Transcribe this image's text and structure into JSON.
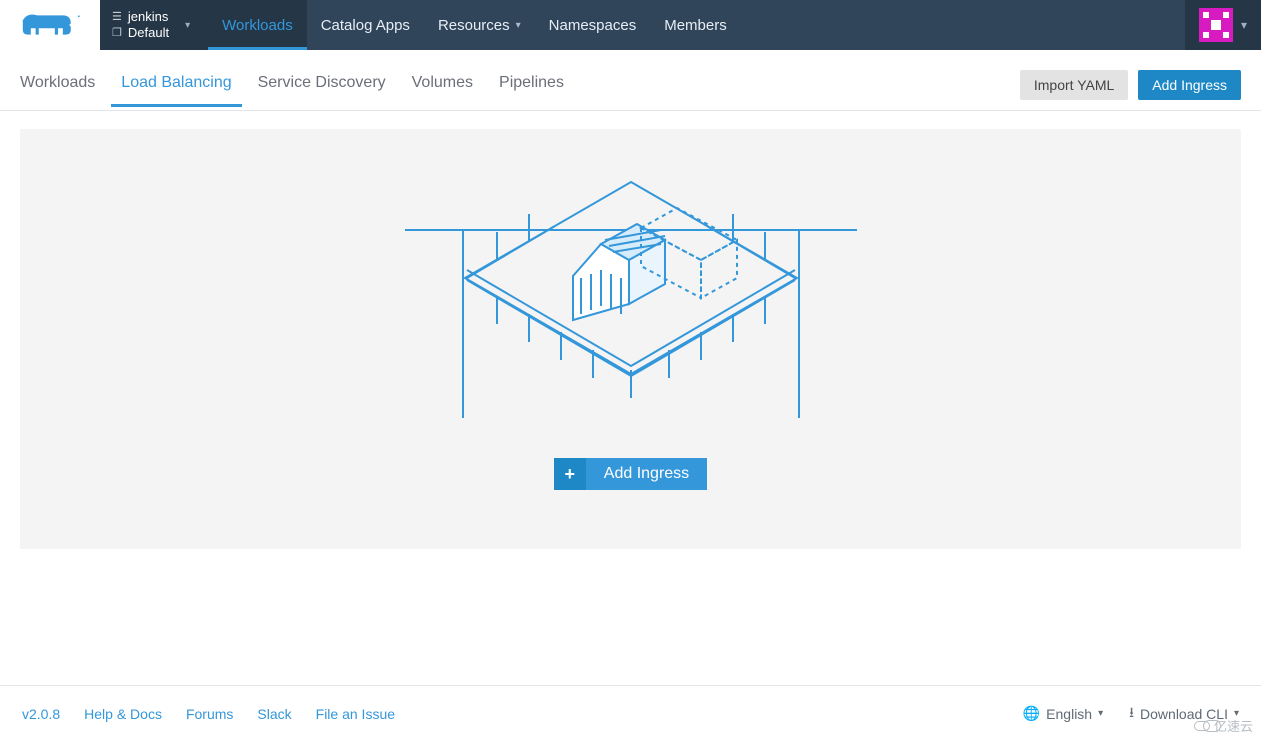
{
  "header": {
    "cluster": "jenkins",
    "project": "Default",
    "nav": [
      {
        "label": "Workloads",
        "active": true
      },
      {
        "label": "Catalog Apps"
      },
      {
        "label": "Resources",
        "caret": true
      },
      {
        "label": "Namespaces"
      },
      {
        "label": "Members"
      }
    ]
  },
  "tabs": [
    {
      "label": "Workloads"
    },
    {
      "label": "Load Balancing",
      "active": true
    },
    {
      "label": "Service Discovery"
    },
    {
      "label": "Volumes"
    },
    {
      "label": "Pipelines"
    }
  ],
  "actions": {
    "import_yaml": "Import YAML",
    "add_ingress": "Add Ingress"
  },
  "empty": {
    "cta": "Add Ingress"
  },
  "footer": {
    "version": "v2.0.8",
    "links": [
      "Help & Docs",
      "Forums",
      "Slack",
      "File an Issue"
    ],
    "language": "English",
    "download": "Download CLI"
  },
  "watermark": "亿速云"
}
